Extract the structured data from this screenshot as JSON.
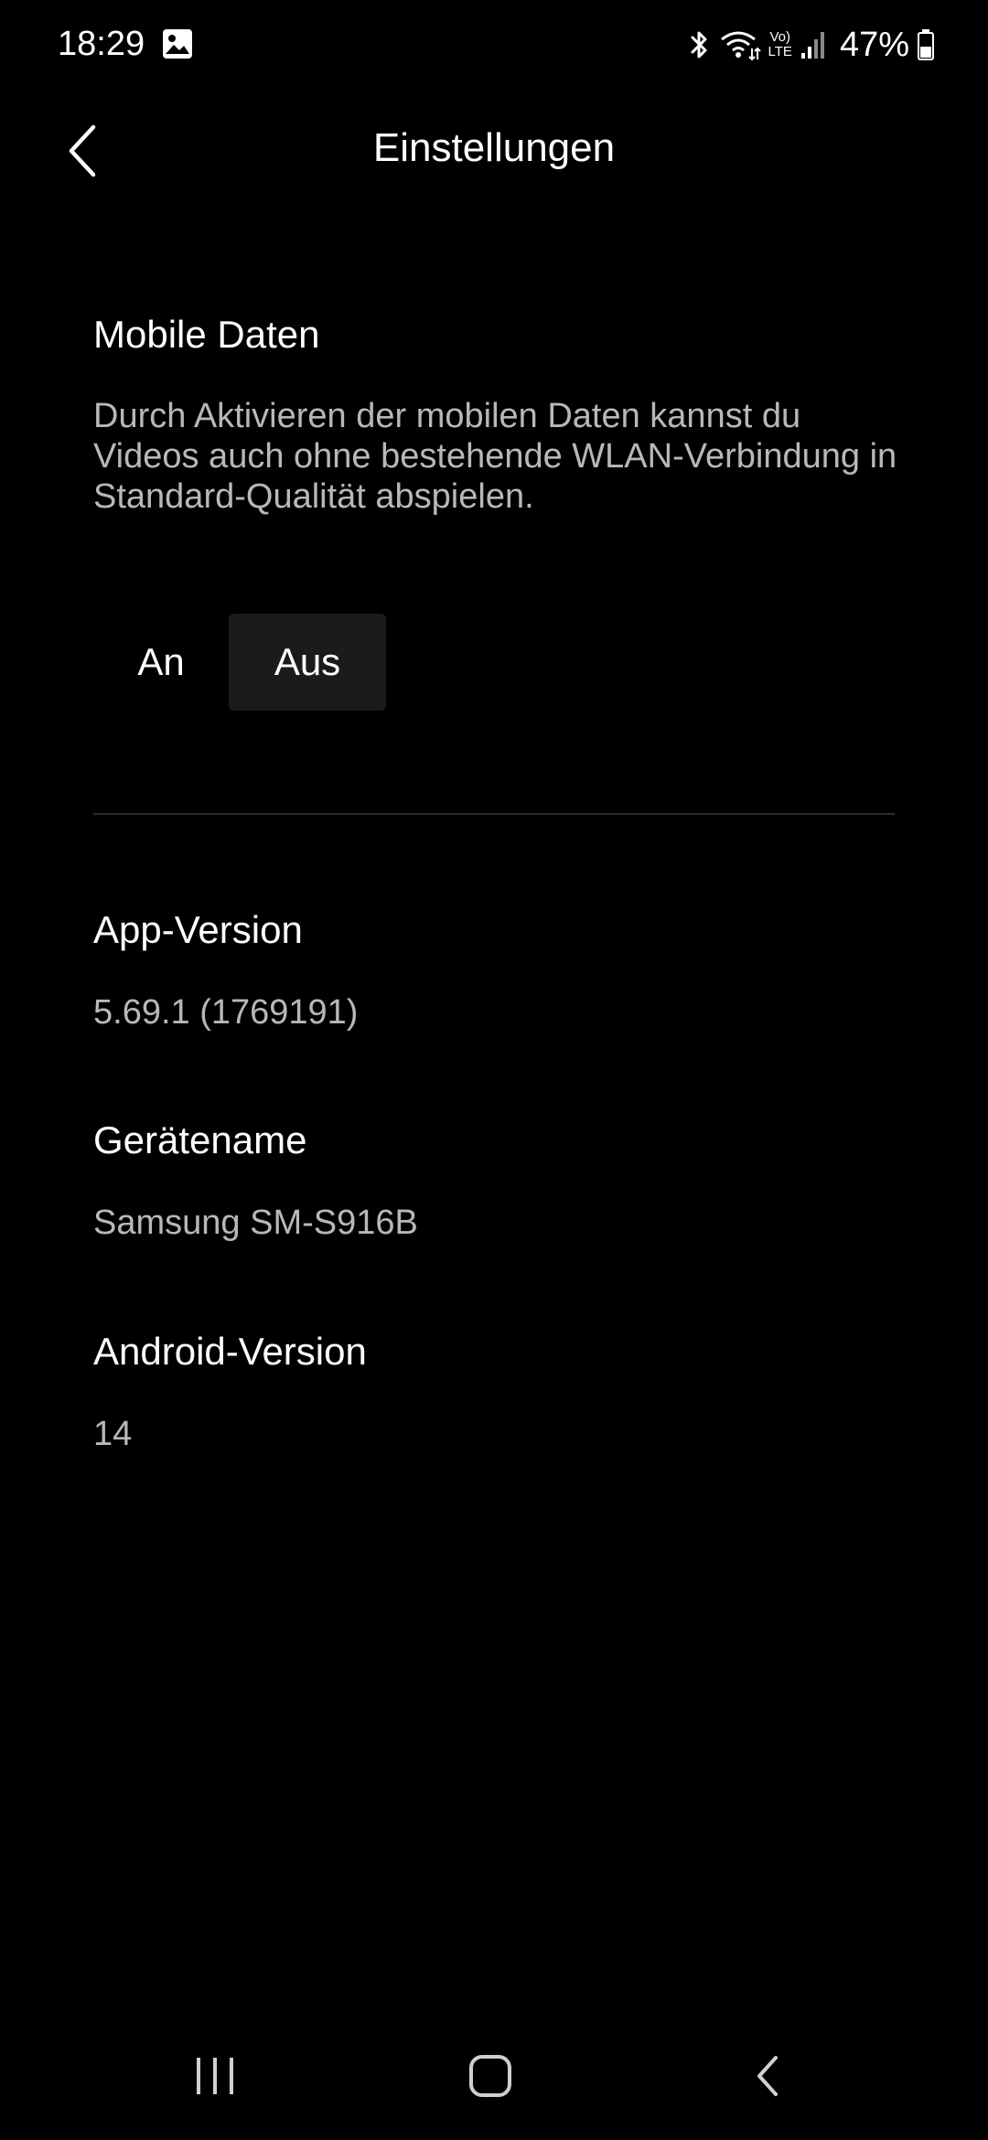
{
  "status_bar": {
    "time": "18:29",
    "battery": "47%",
    "icons": [
      "gallery-icon",
      "bluetooth-icon",
      "wifi-icon",
      "volte-icon",
      "signal-icon",
      "battery-icon"
    ],
    "volte_top": "Vo)",
    "volte_bottom": "LTE"
  },
  "header": {
    "title": "Einstellungen",
    "back_icon": "chevron-left-icon"
  },
  "mobile_data": {
    "title": "Mobile Daten",
    "description": "Durch Aktivieren der mobilen Daten kannst du Videos auch ohne bestehende WLAN-Verbindung in Standard-Qualität abspielen.",
    "options": [
      "An",
      "Aus"
    ],
    "selected": "Aus"
  },
  "info": {
    "app_version_label": "App-Version",
    "app_version_value": "5.69.1 (1769191)",
    "device_name_label": "Gerätename",
    "device_name_value": "Samsung SM-S916B",
    "android_version_label": "Android-Version",
    "android_version_value": "14"
  },
  "nav_bar": {
    "icons": [
      "recent-apps-icon",
      "home-icon",
      "back-icon"
    ]
  },
  "colors": {
    "background": "#000000",
    "text_primary": "#ffffff",
    "text_secondary": "#b8b8b8",
    "selected_segment": "#1b1b1b",
    "divider": "#2c2c2c"
  }
}
